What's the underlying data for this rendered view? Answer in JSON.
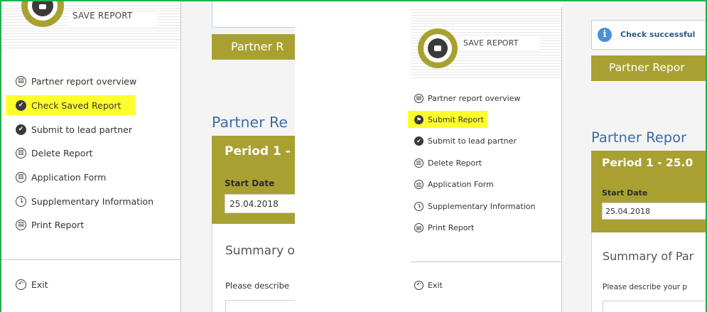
{
  "left": {
    "save_label": "SAVE REPORT",
    "menu": [
      {
        "icon": "overview-icon",
        "glyph": "▤",
        "label": "Partner report overview",
        "filled": false,
        "highlighted": false
      },
      {
        "icon": "check-icon",
        "glyph": "✔",
        "label": "Check Saved Report",
        "filled": true,
        "highlighted": true
      },
      {
        "icon": "check-icon",
        "glyph": "✔",
        "label": "Submit to lead partner",
        "filled": true,
        "highlighted": false
      },
      {
        "icon": "trash-icon",
        "glyph": "▥",
        "label": "Delete Report",
        "filled": false,
        "highlighted": false
      },
      {
        "icon": "bank-icon",
        "glyph": "▥",
        "label": "Application Form",
        "filled": false,
        "highlighted": false
      },
      {
        "icon": "corner-arrow-icon",
        "glyph": "↴",
        "label": "Supplementary Information",
        "filled": false,
        "highlighted": false
      },
      {
        "icon": "print-icon",
        "glyph": "▤",
        "label": "Print Report",
        "filled": false,
        "highlighted": false
      }
    ],
    "exit_label": "Exit",
    "banner": "Partner R",
    "heading": "Partner Re",
    "period_title": "Period 1 -",
    "start_label": "Start Date",
    "start_value": "25.04.2018",
    "summary_title": "Summary o",
    "describe": "Please describe"
  },
  "right": {
    "save_label": "SAVE REPORT",
    "notice": "Check successful",
    "menu": [
      {
        "icon": "overview-icon",
        "glyph": "▤",
        "label": "Partner report overview",
        "filled": false,
        "highlighted": false
      },
      {
        "icon": "flag-icon",
        "glyph": "⚑",
        "label": "Submit Report",
        "filled": true,
        "highlighted": true
      },
      {
        "icon": "check-icon",
        "glyph": "✔",
        "label": "Submit to lead partner",
        "filled": true,
        "highlighted": false
      },
      {
        "icon": "trash-icon",
        "glyph": "▥",
        "label": "Delete Report",
        "filled": false,
        "highlighted": false
      },
      {
        "icon": "bank-icon",
        "glyph": "▥",
        "label": "Application Form",
        "filled": false,
        "highlighted": false
      },
      {
        "icon": "corner-arrow-icon",
        "glyph": "↴",
        "label": "Supplementary Information",
        "filled": false,
        "highlighted": false
      },
      {
        "icon": "print-icon",
        "glyph": "▤",
        "label": "Print Report",
        "filled": false,
        "highlighted": false
      }
    ],
    "exit_label": "Exit",
    "banner": "Partner Repor",
    "heading": "Partner Repor",
    "period_title": "Period 1 - 25.0",
    "start_label": "Start Date",
    "start_value": "25.04.2018",
    "summary_title": "Summary of Par",
    "describe": "Please describe your p"
  },
  "exit_glyph": "↶",
  "colors": {
    "olive": "#a8a132",
    "highlight": "#ffff2e",
    "heading_blue": "#3e6da3",
    "frame_green": "#22b14c",
    "info_blue": "#4a90d9"
  }
}
